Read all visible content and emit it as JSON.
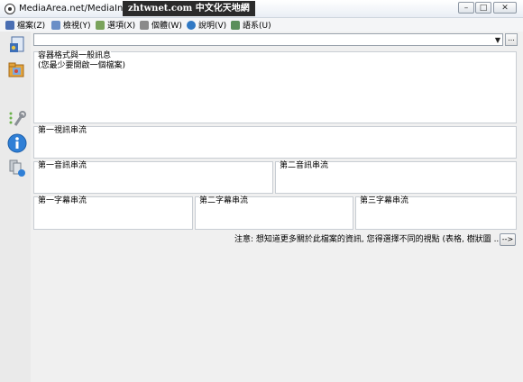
{
  "window": {
    "title": "MediaArea.net/MediaInfo",
    "watermark": "zhtwnet.com 中文化天地網",
    "controls": {
      "minimize": "–",
      "maximize": "□",
      "close": "✕"
    }
  },
  "menu": [
    {
      "label": "檔案(Z)",
      "icon": "file-menu-icon",
      "color": "#4a6fb3"
    },
    {
      "label": "檢視(Y)",
      "icon": "view-menu-icon",
      "color": "#6b8fc7"
    },
    {
      "label": "選項(X)",
      "icon": "options-menu-icon",
      "color": "#7aa35b"
    },
    {
      "label": "個體(W)",
      "icon": "debug-menu-icon",
      "color": "#8a8a8a"
    },
    {
      "label": "說明(V)",
      "icon": "help-menu-icon",
      "color": "#2f78c4"
    },
    {
      "label": "語系(U)",
      "icon": "language-menu-icon",
      "color": "#5a8f5a"
    }
  ],
  "combo": {
    "value": "",
    "arrow": "▼",
    "button": "..."
  },
  "panels": {
    "general": {
      "label": "容器格式與一般訊息",
      "sub": "(您最少要開啟一個檔案)"
    },
    "video1": {
      "label": "第一視訊串流"
    },
    "audio1": {
      "label": "第一音訊串流"
    },
    "audio2": {
      "label": "第二音訊串流"
    },
    "text1": {
      "label": "第一字幕串流"
    },
    "text2": {
      "label": "第二字幕串流"
    },
    "text3": {
      "label": "第三字幕串流"
    }
  },
  "note": "注意: 想知道更多關於此檔案的資訊, 您得選擇不同的視點 (表格, 樹狀圖 ...)",
  "go_button": "-->"
}
